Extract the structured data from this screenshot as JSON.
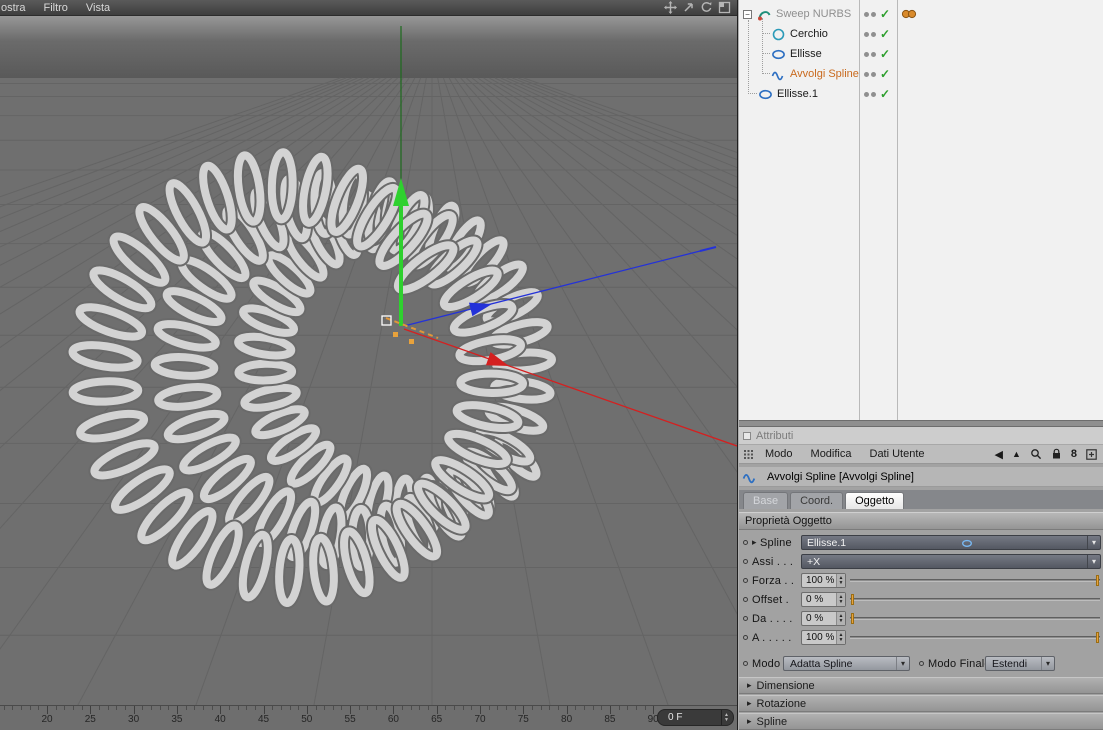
{
  "viewport": {
    "menu_items": [
      "ostra",
      "Filtro",
      "Vista"
    ],
    "frame_field": "0 F",
    "ruler_labels": [
      "20",
      "25",
      "30",
      "35",
      "40",
      "45",
      "50",
      "55",
      "60",
      "65",
      "70",
      "75",
      "80",
      "85",
      "90"
    ]
  },
  "object_manager": {
    "items": [
      {
        "label": "Sweep NURBS"
      },
      {
        "label": "Cerchio"
      },
      {
        "label": "Ellisse"
      },
      {
        "label": "Avvolgi Spline"
      },
      {
        "label": "Ellisse.1"
      }
    ]
  },
  "attributes": {
    "panel_title": "Attributi",
    "menu_items": [
      "Modo",
      "Modifica",
      "Dati Utente"
    ],
    "bridge_label": "8",
    "object_title": "Avvolgi Spline  [Avvolgi Spline]",
    "tabs": [
      "Base",
      "Coord.",
      "Oggetto"
    ],
    "section_header": "Proprietà Oggetto",
    "rows": {
      "spline": {
        "label": "Spline",
        "value": "Ellisse.1"
      },
      "assi": {
        "label": "Assi . . .",
        "value": "+X"
      },
      "forza": {
        "label": "Forza . .",
        "value": "100 %",
        "percent": 100
      },
      "offset": {
        "label": "Offset .",
        "value": "0 %",
        "percent": 0
      },
      "da": {
        "label": "Da . . . .",
        "value": "0 %",
        "percent": 0
      },
      "a": {
        "label": "A . . . . .",
        "value": "100 %",
        "percent": 100
      },
      "modo": {
        "label": "Modo",
        "value": "Adatta Spline"
      },
      "modo_finale": {
        "label": "Modo Finale",
        "value": "Estendi"
      }
    },
    "sections": [
      "Dimensione",
      "Rotazione",
      "Spline"
    ]
  }
}
